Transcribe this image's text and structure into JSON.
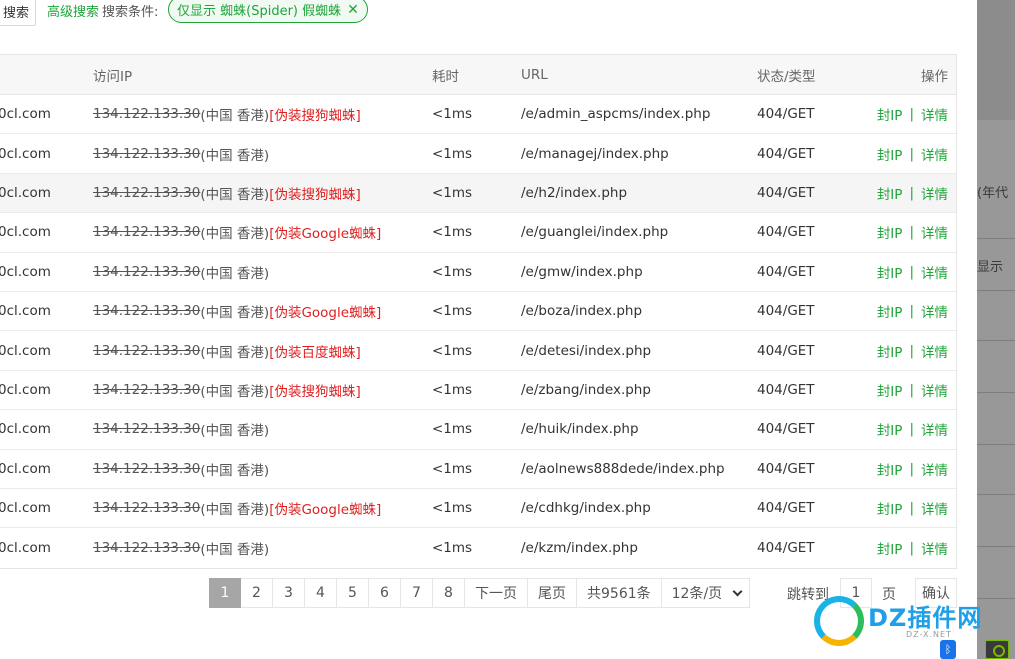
{
  "toolbar": {
    "search_label": "搜索",
    "advanced_label": "高级搜索",
    "conditions_label": "搜索条件:",
    "filter_tag": "仅显示 蜘蛛(Spider) 假蜘蛛"
  },
  "columns": [
    "访问IP",
    "耗时",
    "URL",
    "状态/类型",
    "操作"
  ],
  "rows": [
    {
      "domain": "0cl.com",
      "ip": "134.122.133.30",
      "loc": "(中国 香港)",
      "tag": "[伪装搜狗蜘蛛]",
      "time": "<1ms",
      "url": "/e/admin_aspcms/index.php",
      "status": "404/GET"
    },
    {
      "domain": "0cl.com",
      "ip": "134.122.133.30",
      "loc": "(中国 香港)",
      "tag": "",
      "time": "<1ms",
      "url": "/e/managej/index.php",
      "status": "404/GET"
    },
    {
      "domain": "0cl.com",
      "ip": "134.122.133.30",
      "loc": "(中国 香港)",
      "tag": "[伪装搜狗蜘蛛]",
      "time": "<1ms",
      "url": "/e/h2/index.php",
      "status": "404/GET"
    },
    {
      "domain": "0cl.com",
      "ip": "134.122.133.30",
      "loc": "(中国 香港)",
      "tag": "[伪装Google蜘蛛]",
      "time": "<1ms",
      "url": "/e/guanglei/index.php",
      "status": "404/GET"
    },
    {
      "domain": "0cl.com",
      "ip": "134.122.133.30",
      "loc": "(中国 香港)",
      "tag": "",
      "time": "<1ms",
      "url": "/e/gmw/index.php",
      "status": "404/GET"
    },
    {
      "domain": "0cl.com",
      "ip": "134.122.133.30",
      "loc": "(中国 香港)",
      "tag": "[伪装Google蜘蛛]",
      "time": "<1ms",
      "url": "/e/boza/index.php",
      "status": "404/GET"
    },
    {
      "domain": "0cl.com",
      "ip": "134.122.133.30",
      "loc": "(中国 香港)",
      "tag": "[伪装百度蜘蛛]",
      "time": "<1ms",
      "url": "/e/detesi/index.php",
      "status": "404/GET"
    },
    {
      "domain": "0cl.com",
      "ip": "134.122.133.30",
      "loc": "(中国 香港)",
      "tag": "[伪装搜狗蜘蛛]",
      "time": "<1ms",
      "url": "/e/zbang/index.php",
      "status": "404/GET"
    },
    {
      "domain": "0cl.com",
      "ip": "134.122.133.30",
      "loc": "(中国 香港)",
      "tag": "",
      "time": "<1ms",
      "url": "/e/huik/index.php",
      "status": "404/GET"
    },
    {
      "domain": "0cl.com",
      "ip": "134.122.133.30",
      "loc": "(中国 香港)",
      "tag": "",
      "time": "<1ms",
      "url": "/e/aolnews888dede/index.php",
      "status": "404/GET"
    },
    {
      "domain": "0cl.com",
      "ip": "134.122.133.30",
      "loc": "(中国 香港)",
      "tag": "[伪装Google蜘蛛]",
      "time": "<1ms",
      "url": "/e/cdhkg/index.php",
      "status": "404/GET"
    },
    {
      "domain": "0cl.com",
      "ip": "134.122.133.30",
      "loc": "(中国 香港)",
      "tag": "",
      "time": "<1ms",
      "url": "/e/kzm/index.php",
      "status": "404/GET"
    }
  ],
  "ops": {
    "block": "封IP",
    "sep": "|",
    "detail": "详情"
  },
  "pagination": {
    "pages": [
      "1",
      "2",
      "3",
      "4",
      "5",
      "6",
      "7",
      "8"
    ],
    "current": "1",
    "next": "下一页",
    "last": "尾页",
    "total": "共9561条",
    "page_size": "12条/页",
    "jump_label": "跳转到",
    "jump_value": "1",
    "page_unit": "页",
    "confirm": "确认"
  },
  "background": {
    "text1": "(年代",
    "text2": "显示"
  },
  "watermark": {
    "brand": "DZ插件网",
    "sub": "DZ-X.NET"
  },
  "tray": {
    "bluetooth": "ᛒ"
  },
  "colors": {
    "accent": "#20a53a",
    "fake": "#e02020",
    "active_page": "#a6a6a6"
  }
}
